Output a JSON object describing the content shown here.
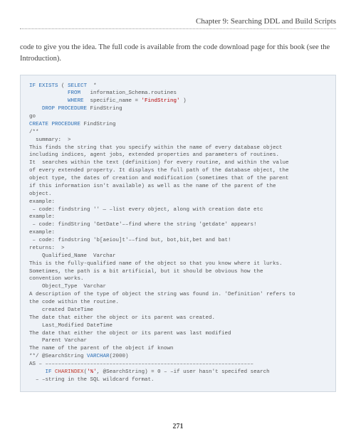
{
  "header": {
    "chapter_title": "Chapter 9: Searching DDL and Build Scripts"
  },
  "intro": "code to give you the idea. The full code is available from the code download page for this book (see the Introduction).",
  "page_number": "271",
  "code": {
    "l1a": "IF",
    "l1b": "EXISTS",
    "l1c": " ( ",
    "l1d": "SELECT",
    "l1e": "  *",
    "l2a": "            ",
    "l2b": "FROM",
    "l2c": "   information_Schema.routines",
    "l3a": "            ",
    "l3b": "WHERE",
    "l3c": "  specific_name = ",
    "l3d": "'FindString'",
    "l3e": " )",
    "l4a": "    ",
    "l4b": "DROP",
    "l4c": " ",
    "l4d": "PROCEDURE",
    "l4e": " FindString",
    "l5": "go",
    "l6a": "CREATE",
    "l6b": " ",
    "l6c": "PROCEDURE",
    "l6d": " FindString",
    "l7": "/**",
    "l8": "  summary:  >",
    "l9": "This finds the string that you specify within the name of every database object",
    "l10": "including indices, agent jobs, extended properties and parameters of routines.",
    "l11": "It  searches within the text (definition) for every routine, and within the value",
    "l12": "of every extended property. It displays the full path of the database object, the",
    "l13": "object type, the dates of creation and modification (sometimes that of the parent",
    "l14": "if this information isn't available) as well as the name of the parent of the",
    "l15": "object.",
    "l16": "example:",
    "l17": " – code: findstring '' — –list every object, along with creation date etc",
    "l18": "example:",
    "l19": " – code: findString 'GetDate'––find where the string 'getdate' appears!",
    "l20": "example:",
    "l21": " – code: findstring 'b[aeiou]t'––find but, bot,bit,bet and bat!",
    "l22": "returns:  >",
    "l23": "    Qualified_Name  Varchar",
    "l24": "This is the fully-qualified name of the object so that you know where it lurks.",
    "l25": "Sometimes, the path is a bit artificial, but it should be obvious how the",
    "l26": "convention works.",
    "l27": "    Object_Type  Varchar",
    "l28": "A description of the type of object the string was found in. 'Definition' refers to",
    "l29": "the code within the routine.",
    "l30": "    created DateTime",
    "l31": "The date that either the object or its parent was created.",
    "l32": "    Last_Modified DateTime",
    "l33": "The date that either the object or its parent was last modified",
    "l34": "    Parent Varchar",
    "l35": "The name of the parent of the object if known",
    "l36": "**/ @SearchString ",
    "l36b": "VARCHAR",
    "l36c": "(2000)",
    "l37": "AS – –––––––––––––––––––––––––––––––––––––––––––––––––––––––––––––––––",
    "l38a": "     ",
    "l38b": "IF",
    "l38c": " ",
    "l38d": "CHARINDEX",
    "l38e": "(",
    "l38f": "'%'",
    "l38g": ", @SearchString) = 0 – –if user hasn't specifed search",
    "l39": "  – –string in the SQL wildcard format."
  }
}
